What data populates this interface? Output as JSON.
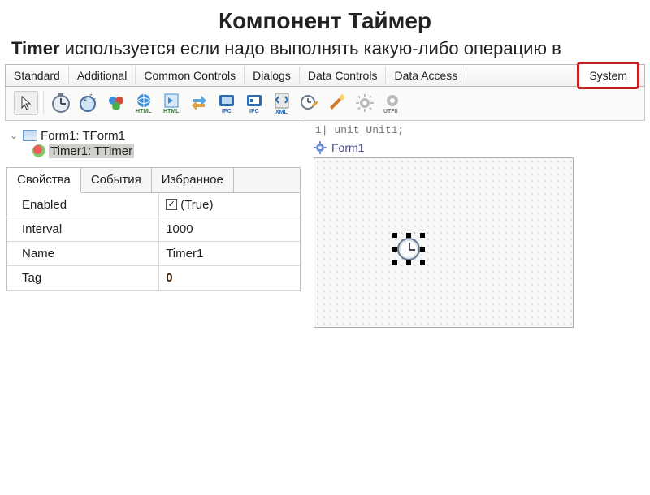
{
  "slide": {
    "title": "Компонент Таймер",
    "desc_prefix": "Timer",
    "desc_rest": " используется если надо выполнять какую-либо операцию в"
  },
  "palette": {
    "tabs": [
      "Standard",
      "Additional",
      "Common Controls",
      "Dialogs",
      "Data Controls",
      "Data Access"
    ],
    "highlighted": "System"
  },
  "toolbar_icons": [
    "cursor-icon",
    "timer-icon",
    "idle-timer-icon",
    "pipe-icon",
    "html-icon",
    "htmlalt-icon",
    "convert-icon",
    "ipc-icon",
    "ipc-alt-icon",
    "xml-icon",
    "clock-edit-icon",
    "wand-icon",
    "gear-icon",
    "utf8-icon"
  ],
  "tree": {
    "root": "Form1: TForm1",
    "child": "Timer1: TTimer"
  },
  "inspector": {
    "tabs": {
      "properties": "Свойства",
      "events": "События",
      "favorites": "Избранное"
    },
    "active_tab": "properties",
    "rows": [
      {
        "name": "Enabled",
        "value": "(True)",
        "checkbox": true
      },
      {
        "name": "Interval",
        "value": "1000"
      },
      {
        "name": "Name",
        "value": "Timer1"
      },
      {
        "name": "Tag",
        "value": "0",
        "bold": true
      }
    ]
  },
  "code_scrap": "1| unit Unit1;",
  "designer": {
    "caption": "Form1"
  }
}
